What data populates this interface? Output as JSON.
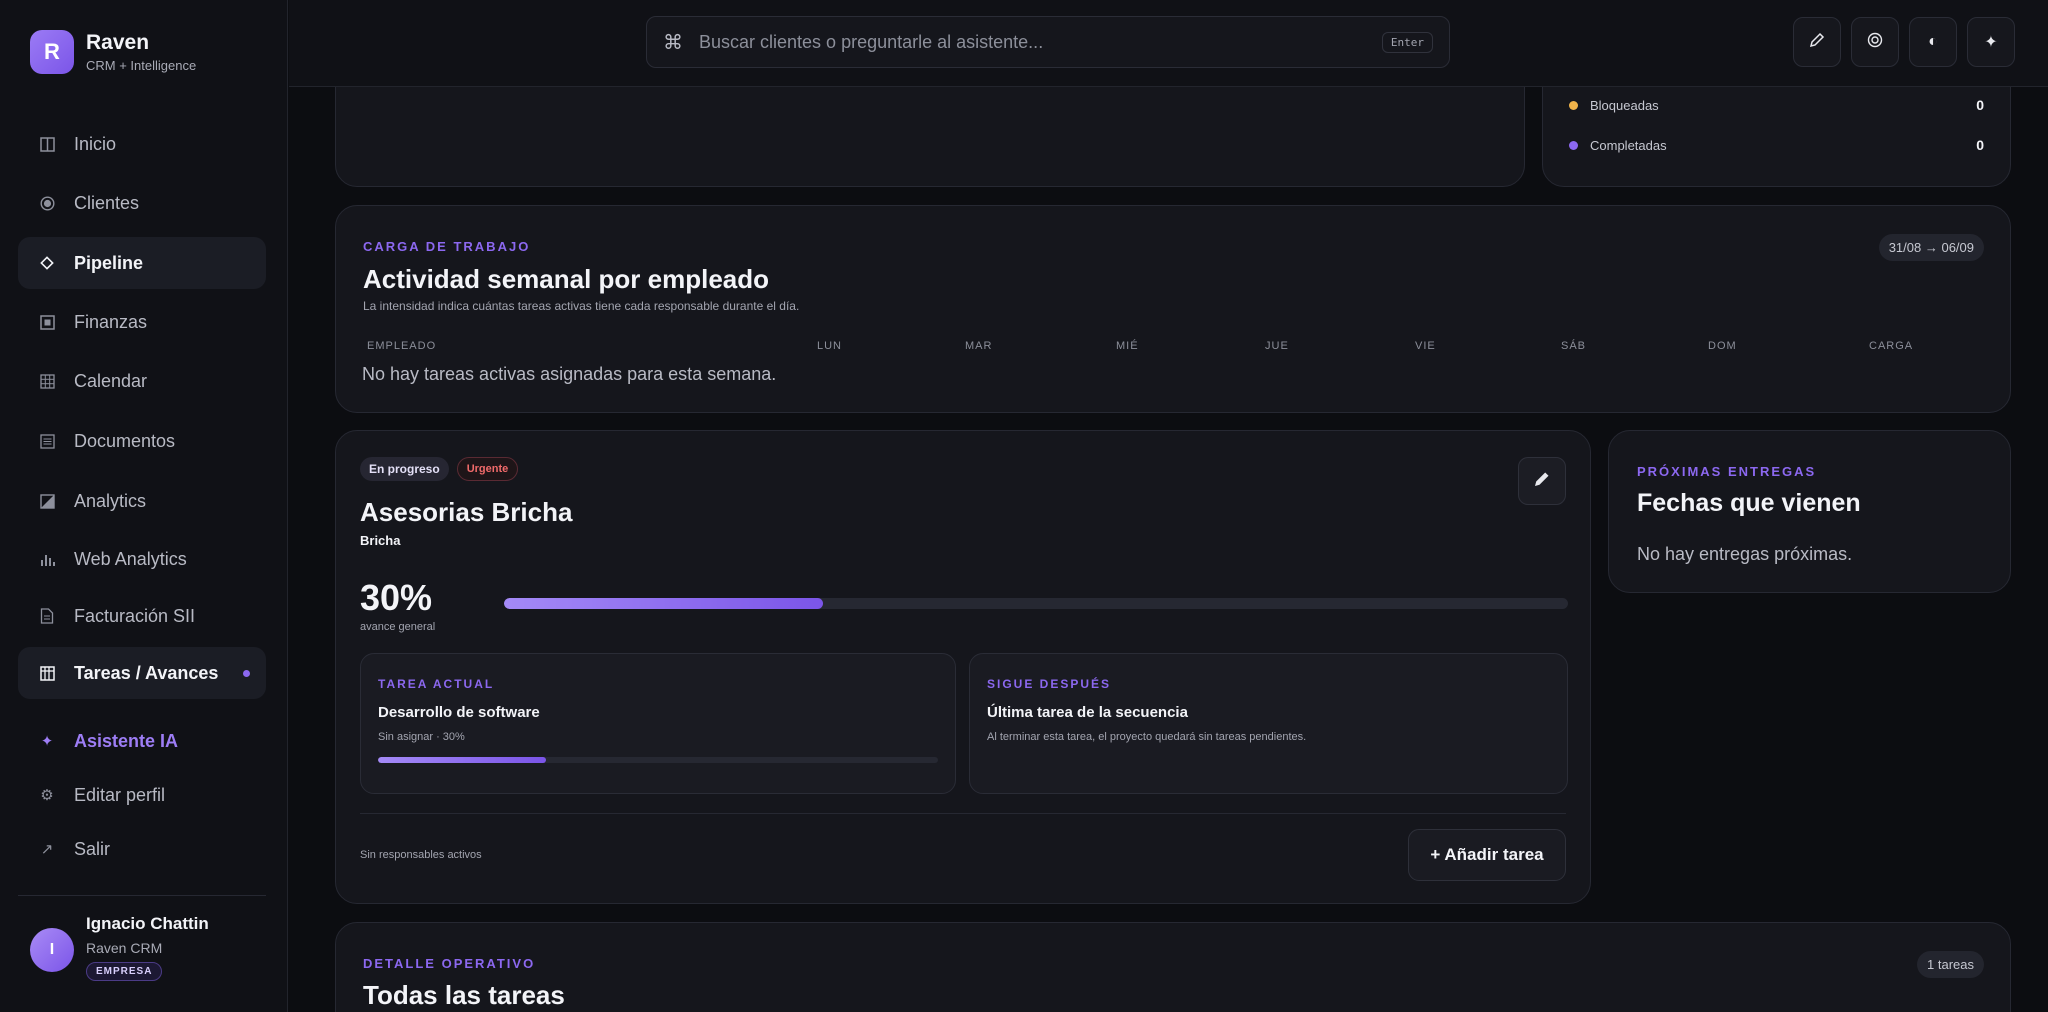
{
  "brand": {
    "logo_letter": "R",
    "name": "Raven",
    "subtitle": "CRM + Intelligence"
  },
  "nav": {
    "items": [
      {
        "label": "Inicio",
        "icon": "columns-icon"
      },
      {
        "label": "Clientes",
        "icon": "target-icon"
      },
      {
        "label": "Pipeline",
        "icon": "diamond-icon",
        "active": true
      },
      {
        "label": "Finanzas",
        "icon": "square-dot-icon"
      },
      {
        "label": "Calendar",
        "icon": "grid-icon"
      },
      {
        "label": "Documentos",
        "icon": "list-icon"
      },
      {
        "label": "Analytics",
        "icon": "half-square-icon"
      },
      {
        "label": "Web Analytics",
        "icon": "bar-chart-icon"
      },
      {
        "label": "Facturación SII",
        "icon": "file-icon"
      },
      {
        "label": "Tareas / Avances",
        "icon": "table-icon",
        "active": true,
        "has_dot": true
      }
    ],
    "ai_label": "Asistente IA",
    "edit_profile_label": "Editar perfil",
    "logout_label": "Salir"
  },
  "user": {
    "initial": "I",
    "name": "Ignacio Chattin",
    "org": "Raven CRM",
    "badge": "EMPRESA"
  },
  "search": {
    "placeholder": "Buscar clientes o preguntarle al asistente...",
    "hint": "Enter"
  },
  "status_legend": [
    {
      "label": "Bloqueadas",
      "value": "0",
      "color": "#f0b34a"
    },
    {
      "label": "Completadas",
      "value": "0",
      "color": "#8c68f0"
    }
  ],
  "workload": {
    "eyebrow": "CARGA DE TRABAJO",
    "title": "Actividad semanal por empleado",
    "description": "La intensidad indica cuántas tareas activas tiene cada responsable durante el día.",
    "date_range": "31/08 → 06/09",
    "columns": [
      "EMPLEADO",
      "LUN",
      "MAR",
      "MIÉ",
      "JUE",
      "VIE",
      "SÁB",
      "DOM",
      "CARGA"
    ],
    "empty_text": "No hay tareas activas asignadas para esta semana."
  },
  "project": {
    "status_tag": "En progreso",
    "priority_tag": "Urgente",
    "name": "Asesorias Bricha",
    "client": "Bricha",
    "progress_label": "30%",
    "progress_value": 0.3,
    "progress_caption": "avance general",
    "current_task": {
      "eyebrow": "TAREA ACTUAL",
      "title": "Desarrollo de software",
      "meta": "Sin asignar · 30%",
      "progress_value": 0.3
    },
    "next_task": {
      "eyebrow": "SIGUE DESPUÉS",
      "title": "Última tarea de la secuencia",
      "meta": "Al terminar esta tarea, el proyecto quedará sin tareas pendientes."
    },
    "footer_text": "Sin responsables activos",
    "add_task_label": "+ Añadir tarea"
  },
  "deliveries": {
    "eyebrow": "PRÓXIMAS ENTREGAS",
    "title": "Fechas que vienen",
    "empty_text": "No hay entregas próximas."
  },
  "detail": {
    "eyebrow": "DETALLE OPERATIVO",
    "title": "Todas las tareas",
    "count": "1 tareas"
  },
  "colors": {
    "accent": "#8c68f0",
    "background": "#0c0d11",
    "card": "#15161c",
    "urgent": "#f06a6a"
  }
}
